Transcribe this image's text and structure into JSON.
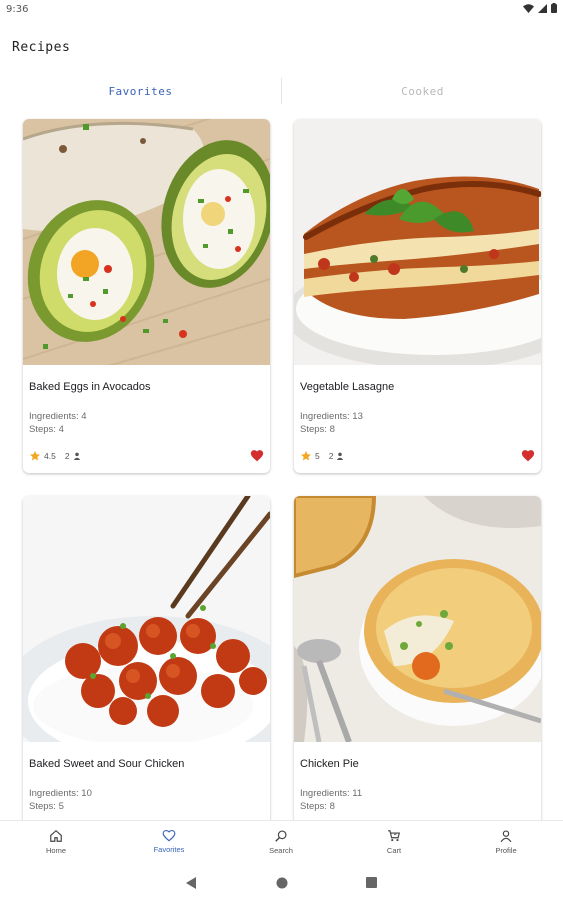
{
  "status_bar": {
    "time": "9:36"
  },
  "app": {
    "title": "Recipes"
  },
  "tabs": [
    {
      "label": "Favorites",
      "active": true
    },
    {
      "label": "Cooked",
      "active": false
    }
  ],
  "recipes": [
    {
      "title": "Baked Eggs in Avocados",
      "ingredients": "Ingredients: 4",
      "steps": "Steps: 4",
      "rating": "4.5",
      "cooks": "2",
      "favorite": true
    },
    {
      "title": "Vegetable Lasagne",
      "ingredients": "Ingredients: 13",
      "steps": "Steps: 8",
      "rating": "5",
      "cooks": "2",
      "favorite": true
    },
    {
      "title": "Baked Sweet and Sour Chicken",
      "ingredients": "Ingredients: 10",
      "steps": "Steps: 5"
    },
    {
      "title": "Chicken Pie",
      "ingredients": "Ingredients: 11",
      "steps": "Steps: 8"
    }
  ],
  "bottom_nav": [
    {
      "label": "Home",
      "icon": "home-icon"
    },
    {
      "label": "Favorites",
      "icon": "heart-outline-icon",
      "active": true
    },
    {
      "label": "Search",
      "icon": "search-icon"
    },
    {
      "label": "Cart",
      "icon": "cart-icon"
    },
    {
      "label": "Profile",
      "icon": "person-icon"
    }
  ],
  "colors": {
    "accent": "#3b63b8",
    "heart": "#d32f2f",
    "star": "#f4a522",
    "inactive_tab": "#b8b8b8"
  }
}
